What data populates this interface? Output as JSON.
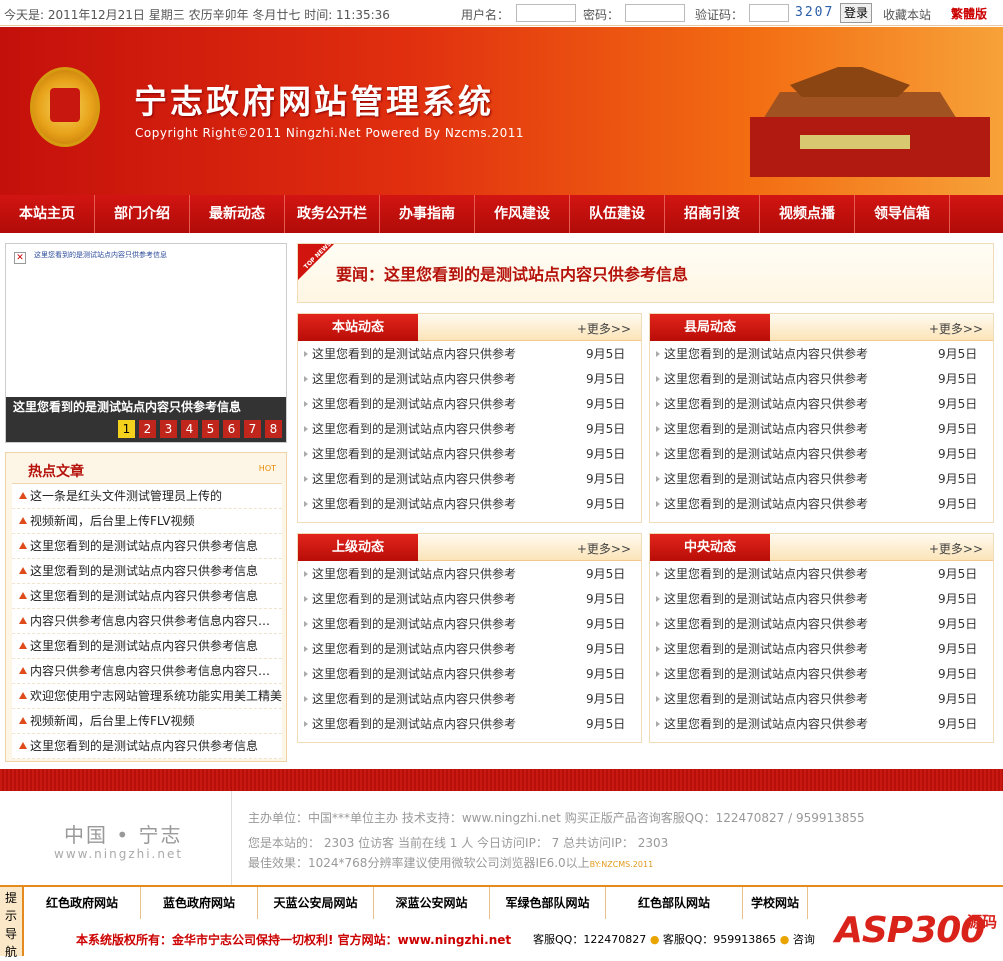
{
  "topbar": {
    "date": "今天是: 2011年12月21日  星期三  农历辛卯年  冬月廿七  时间: 11:35:36",
    "user_label": "用户名：",
    "pass_label": "密码：",
    "code_label": "验证码：",
    "captcha": "3207",
    "login": "登录",
    "favorite": "收藏本站",
    "traditional": "繁體版"
  },
  "banner": {
    "title": "宁志政府网站管理系统",
    "copyright": "Copyright Right©2011 Ningzhi.Net Powered By Nzcms.2011"
  },
  "nav": [
    "本站主页",
    "部门介绍",
    "最新动态",
    "政务公开栏",
    "办事指南",
    "作风建设",
    "队伍建设",
    "招商引资",
    "视频点播",
    "领导信箱"
  ],
  "slider": {
    "alt": "这里您看到的是测试站点内容只供参考信息",
    "caption": "这里您看到的是测试站点内容只供参考信息",
    "pages": [
      "1",
      "2",
      "3",
      "4",
      "5",
      "6",
      "7",
      "8"
    ],
    "active": "1"
  },
  "hot": {
    "title": "热点文章",
    "badge": "HOT",
    "items": [
      "这一条是红头文件测试管理员上传的",
      "视频新闻，后台里上传FLV视频",
      "这里您看到的是测试站点内容只供参考信息",
      "这里您看到的是测试站点内容只供参考信息",
      "这里您看到的是测试站点内容只供参考信息",
      "内容只供参考信息内容只供参考信息内容只供参考信息",
      "这里您看到的是测试站点内容只供参考信息",
      "内容只供参考信息内容只供参考信息内容只供参考信息",
      "欢迎您使用宁志网站管理系统功能实用美工精美",
      "视频新闻，后台里上传FLV视频",
      "这里您看到的是测试站点内容只供参考信息"
    ]
  },
  "headline": {
    "tag": "TOP NEWS",
    "text": "要闻：这里您看到的是测试站点内容只供参考信息"
  },
  "boxes": [
    {
      "title": "本站动态",
      "more": "+更多>>",
      "items": [
        [
          "这里您看到的是测试站点内容只供参考",
          "9月5日"
        ],
        [
          "这里您看到的是测试站点内容只供参考",
          "9月5日"
        ],
        [
          "这里您看到的是测试站点内容只供参考",
          "9月5日"
        ],
        [
          "这里您看到的是测试站点内容只供参考",
          "9月5日"
        ],
        [
          "这里您看到的是测试站点内容只供参考",
          "9月5日"
        ],
        [
          "这里您看到的是测试站点内容只供参考",
          "9月5日"
        ],
        [
          "这里您看到的是测试站点内容只供参考",
          "9月5日"
        ]
      ]
    },
    {
      "title": "县局动态",
      "more": "+更多>>",
      "items": [
        [
          "这里您看到的是测试站点内容只供参考",
          "9月5日"
        ],
        [
          "这里您看到的是测试站点内容只供参考",
          "9月5日"
        ],
        [
          "这里您看到的是测试站点内容只供参考",
          "9月5日"
        ],
        [
          "这里您看到的是测试站点内容只供参考",
          "9月5日"
        ],
        [
          "这里您看到的是测试站点内容只供参考",
          "9月5日"
        ],
        [
          "这里您看到的是测试站点内容只供参考",
          "9月5日"
        ],
        [
          "这里您看到的是测试站点内容只供参考",
          "9月5日"
        ]
      ]
    },
    {
      "title": "上级动态",
      "more": "+更多>>",
      "items": [
        [
          "这里您看到的是测试站点内容只供参考",
          "9月5日"
        ],
        [
          "这里您看到的是测试站点内容只供参考",
          "9月5日"
        ],
        [
          "这里您看到的是测试站点内容只供参考",
          "9月5日"
        ],
        [
          "这里您看到的是测试站点内容只供参考",
          "9月5日"
        ],
        [
          "这里您看到的是测试站点内容只供参考",
          "9月5日"
        ],
        [
          "这里您看到的是测试站点内容只供参考",
          "9月5日"
        ],
        [
          "这里您看到的是测试站点内容只供参考",
          "9月5日"
        ]
      ]
    },
    {
      "title": "中央动态",
      "more": "+更多>>",
      "items": [
        [
          "这里您看到的是测试站点内容只供参考",
          "9月5日"
        ],
        [
          "这里您看到的是测试站点内容只供参考",
          "9月5日"
        ],
        [
          "这里您看到的是测试站点内容只供参考",
          "9月5日"
        ],
        [
          "这里您看到的是测试站点内容只供参考",
          "9月5日"
        ],
        [
          "这里您看到的是测试站点内容只供参考",
          "9月5日"
        ],
        [
          "这里您看到的是测试站点内容只供参考",
          "9月5日"
        ],
        [
          "这里您看到的是测试站点内容只供参考",
          "9月5日"
        ]
      ]
    }
  ],
  "footer": {
    "logo_cn": "中国 • 宁志",
    "logo_en": "www.ningzhi.net",
    "line1": "主办单位：中国***单位主办   技术支持：www.ningzhi.net   购买正版产品咨询客服QQ：122470827 / 959913855",
    "line2": "您是本站的： 2303 位访客  当前在线 1 人 今日访问IP： 7  总共访问IP： 2303",
    "line3": "最佳效果：1024*768分辨率建议使用微软公司浏览器IE6.0以上",
    "line3_mark": "BY:NZCMS.2011"
  },
  "links": {
    "side": "提示导航",
    "items": [
      "红色政府网站",
      "蓝色政府网站",
      "天蓝公安局网站",
      "深蓝公安网站",
      "军绿色部队网站",
      "红色部队网站",
      "学校网站"
    ],
    "copyright": "本系统版权所有：金华市宁志公司保持一切权利! 官方网站：www.ningzhi.net",
    "qq1": "客服QQ：122470827",
    "qq2": "客服QQ：959913865",
    "consult": "咨询"
  },
  "watermark": {
    "word": "ASP300",
    "sub": "源码"
  },
  "colors": {
    "primary_red": "#c4100b",
    "accent_orange": "#f36d12"
  }
}
